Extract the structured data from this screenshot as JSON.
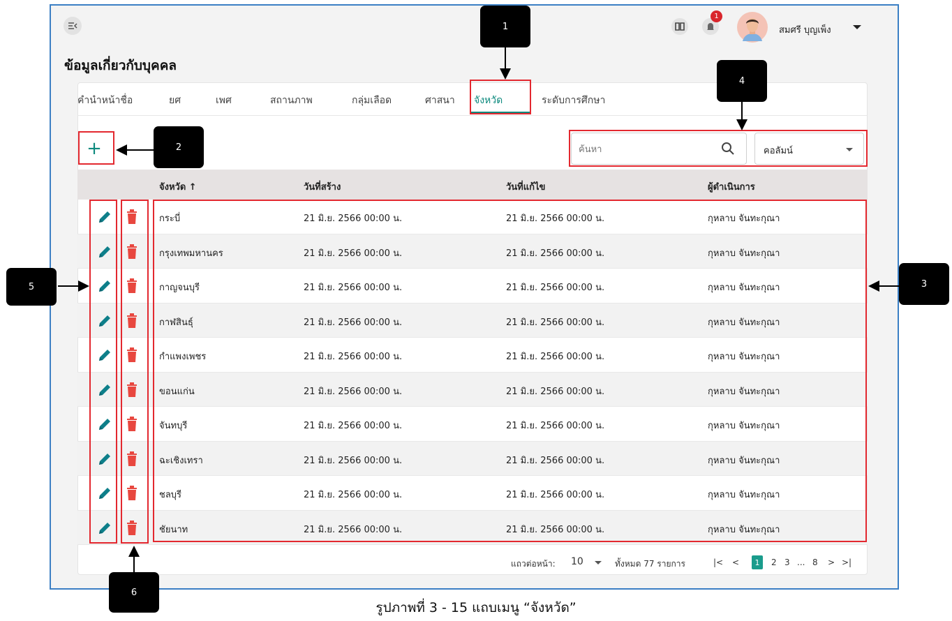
{
  "header": {
    "menu_icon": "menu-collapse-icon",
    "notification_count": "1",
    "user_name": "สมศรี บุญเพ็ง"
  },
  "page": {
    "title": "ข้อมูลเกี่ยวกับบุคคล"
  },
  "tabs": [
    {
      "label": "คำนำหน้าชื่อ"
    },
    {
      "label": "ยศ"
    },
    {
      "label": "เพศ"
    },
    {
      "label": "สถานภาพ"
    },
    {
      "label": "กลุ่มเลือด"
    },
    {
      "label": "ศาสนา"
    },
    {
      "label": "จังหวัด",
      "active": true
    },
    {
      "label": "ระดับการศึกษา"
    }
  ],
  "toolbar": {
    "add_label": "+",
    "search_placeholder": "ค้นหา",
    "column_select_label": "คอลัมน์"
  },
  "table": {
    "columns": [
      "จังหวัด ↑",
      "วันที่สร้าง",
      "วันที่แก้ไข",
      "ผู้ดำเนินการ"
    ],
    "rows": [
      {
        "province": "กระบี่",
        "created": "21 มิ.ย. 2566 00:00 น.",
        "modified": "21 มิ.ย. 2566 00:00 น.",
        "operator": "กุหลาบ จันทะกุณา"
      },
      {
        "province": "กรุงเทพมหานคร",
        "created": "21 มิ.ย. 2566 00:00 น.",
        "modified": "21 มิ.ย. 2566 00:00 น.",
        "operator": "กุหลาบ จันทะกุณา"
      },
      {
        "province": "กาญจนบุรี",
        "created": "21 มิ.ย. 2566 00:00 น.",
        "modified": "21 มิ.ย. 2566 00:00 น.",
        "operator": "กุหลาบ จันทะกุณา"
      },
      {
        "province": "กาฬสินธุ์",
        "created": "21 มิ.ย. 2566 00:00 น.",
        "modified": "21 มิ.ย. 2566 00:00 น.",
        "operator": "กุหลาบ จันทะกุณา"
      },
      {
        "province": "กำแพงเพชร",
        "created": "21 มิ.ย. 2566 00:00 น.",
        "modified": "21 มิ.ย. 2566 00:00 น.",
        "operator": "กุหลาบ จันทะกุณา"
      },
      {
        "province": "ขอนแก่น",
        "created": "21 มิ.ย. 2566 00:00 น.",
        "modified": "21 มิ.ย. 2566 00:00 น.",
        "operator": "กุหลาบ จันทะกุณา"
      },
      {
        "province": "จันทบุรี",
        "created": "21 มิ.ย. 2566 00:00 น.",
        "modified": "21 มิ.ย. 2566 00:00 น.",
        "operator": "กุหลาบ จันทะกุณา"
      },
      {
        "province": "ฉะเชิงเทรา",
        "created": "21 มิ.ย. 2566 00:00 น.",
        "modified": "21 มิ.ย. 2566 00:00 น.",
        "operator": "กุหลาบ จันทะกุณา"
      },
      {
        "province": "ชลบุรี",
        "created": "21 มิ.ย. 2566 00:00 น.",
        "modified": "21 มิ.ย. 2566 00:00 น.",
        "operator": "กุหลาบ จันทะกุณา"
      },
      {
        "province": "ชัยนาท",
        "created": "21 มิ.ย. 2566 00:00 น.",
        "modified": "21 มิ.ย. 2566 00:00 น.",
        "operator": "กุหลาบ จันทะกุณา"
      }
    ]
  },
  "pagination": {
    "rows_per_page_label": "แถวต่อหน้า:",
    "rows_per_page_value": "10",
    "total_label": "ทั้งหมด 77 รายการ",
    "first": "|<",
    "prev": "<",
    "pages": [
      "1",
      "2",
      "3",
      "...",
      "8"
    ],
    "next": ">",
    "last": ">|"
  },
  "callouts": [
    "1",
    "2",
    "3",
    "4",
    "5",
    "6"
  ],
  "caption": "รูปภาพที่ 3 - 15 แถบเมนู “จังหวัด”",
  "colors": {
    "accent": "#0e8a7e",
    "active_page": "#1a9c8c",
    "delete": "#e8473f",
    "edit": "#0e7f8a",
    "highlight": "#e3282f",
    "frame": "#3b7fc4"
  }
}
